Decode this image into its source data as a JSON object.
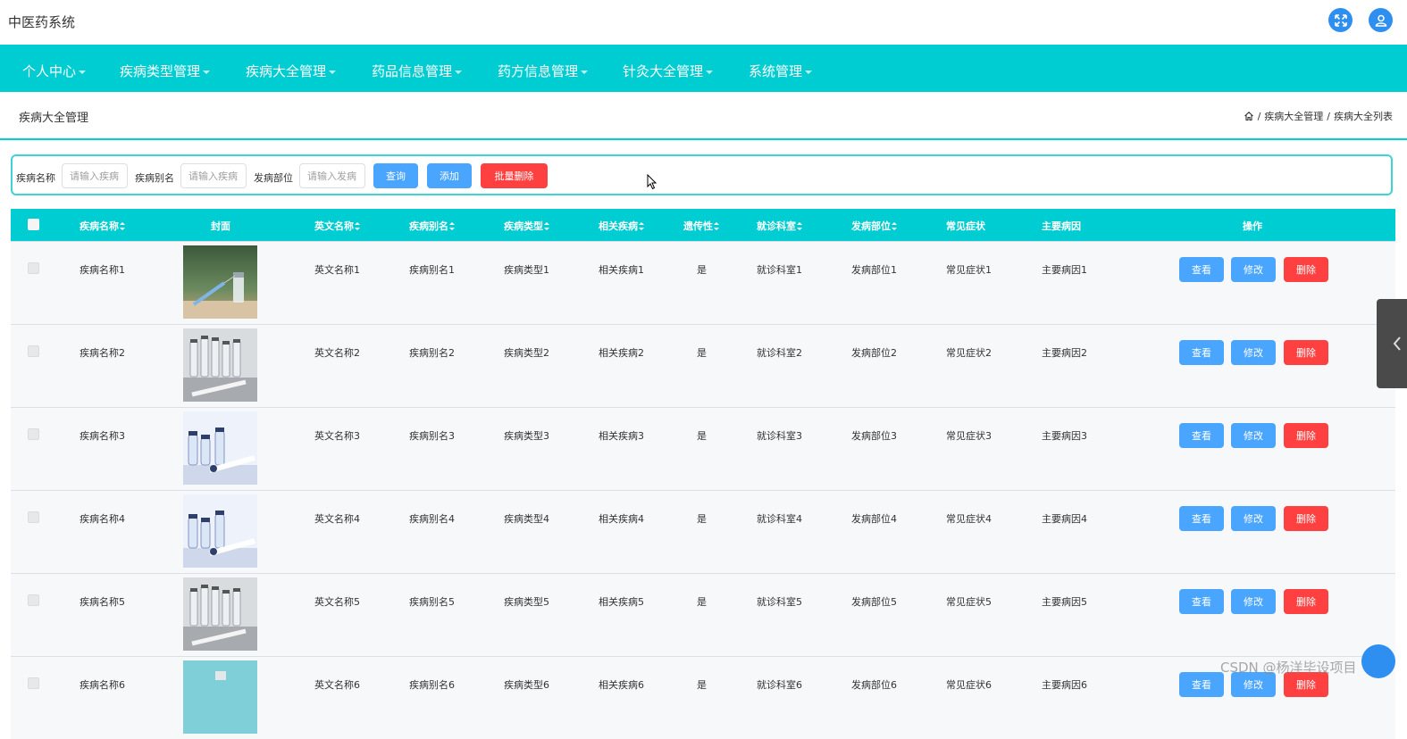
{
  "app": {
    "title": "中医药系统"
  },
  "nav": {
    "items": [
      {
        "label": "个人中心"
      },
      {
        "label": "疾病类型管理"
      },
      {
        "label": "疾病大全管理"
      },
      {
        "label": "药品信息管理"
      },
      {
        "label": "药方信息管理"
      },
      {
        "label": "针灸大全管理"
      },
      {
        "label": "系统管理"
      }
    ]
  },
  "page": {
    "title": "疾病大全管理",
    "breadcrumb": {
      "level1": "疾病大全管理",
      "level2": "疾病大全列表",
      "sep": "/"
    }
  },
  "search": {
    "name_label": "疾病名称",
    "name_placeholder": "请输入疾病",
    "alias_label": "疾病别名",
    "alias_placeholder": "请输入疾病",
    "site_label": "发病部位",
    "site_placeholder": "请输入发病",
    "query_btn": "查询",
    "add_btn": "添加",
    "batch_delete_btn": "批量删除"
  },
  "table": {
    "headers": [
      "疾病名称",
      "封面",
      "英文名称",
      "疾病别名",
      "疾病类型",
      "相关疾病",
      "遗传性",
      "就诊科室",
      "发病部位",
      "常见症状",
      "主要病因",
      "操作"
    ],
    "actions": {
      "view": "查看",
      "edit": "修改",
      "delete": "删除"
    },
    "rows": [
      {
        "name": "疾病名称1",
        "cover": "syringe-vial",
        "english": "英文名称1",
        "alias": "疾病别名1",
        "type": "疾病类型1",
        "related": "相关疾病1",
        "hereditary": "是",
        "dept": "就诊科室1",
        "site": "发病部位1",
        "symptom": "常见症状1",
        "cause": "主要病因1"
      },
      {
        "name": "疾病名称2",
        "cover": "vials-grey",
        "english": "英文名称2",
        "alias": "疾病别名2",
        "type": "疾病类型2",
        "related": "相关疾病2",
        "hereditary": "是",
        "dept": "就诊科室2",
        "site": "发病部位2",
        "symptom": "常见症状2",
        "cause": "主要病因2"
      },
      {
        "name": "疾病名称3",
        "cover": "vials-blue",
        "english": "英文名称3",
        "alias": "疾病别名3",
        "type": "疾病类型3",
        "related": "相关疾病3",
        "hereditary": "是",
        "dept": "就诊科室3",
        "site": "发病部位3",
        "symptom": "常见症状3",
        "cause": "主要病因3"
      },
      {
        "name": "疾病名称4",
        "cover": "vials-blue",
        "english": "英文名称4",
        "alias": "疾病别名4",
        "type": "疾病类型4",
        "related": "相关疾病4",
        "hereditary": "是",
        "dept": "就诊科室4",
        "site": "发病部位4",
        "symptom": "常见症状4",
        "cause": "主要病因4"
      },
      {
        "name": "疾病名称5",
        "cover": "vials-grey",
        "english": "英文名称5",
        "alias": "疾病别名5",
        "type": "疾病类型5",
        "related": "相关疾病5",
        "hereditary": "是",
        "dept": "就诊科室5",
        "site": "发病部位5",
        "symptom": "常见症状5",
        "cause": "主要病因5"
      },
      {
        "name": "疾病名称6",
        "cover": "teal-vial",
        "english": "英文名称6",
        "alias": "疾病别名6",
        "type": "疾病类型6",
        "related": "相关疾病6",
        "hereditary": "是",
        "dept": "就诊科室6",
        "site": "发病部位6",
        "symptom": "常见症状6",
        "cause": "主要病因6"
      }
    ]
  },
  "icons": {
    "fullscreen": "fullscreen-icon",
    "user": "user-icon",
    "home": "home-icon",
    "side": "chevron-left-icon"
  },
  "colors": {
    "primary": "#00cdd1",
    "button_blue": "#4aa5ff",
    "button_red": "#ff4040",
    "icon_blue": "#2f8ff0"
  },
  "watermark": "CSDN @杨洋毕设项目"
}
